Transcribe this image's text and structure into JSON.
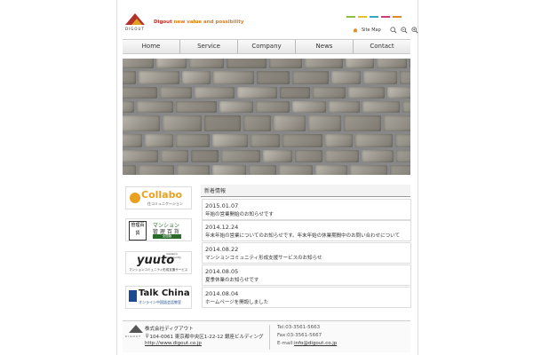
{
  "header": {
    "logo_word": "DIGOUT",
    "tagline_brand": "Digout",
    "tagline_rest": " new value and possibility",
    "colorbar_colors": [
      "#8cbf3f",
      "#e1c22c",
      "#3aa5c9",
      "#d33a7c",
      "#e08a26"
    ],
    "site_map_label": "Site Map",
    "zoom_icons": [
      "zoom-reset-icon",
      "zoom-out-icon",
      "zoom-in-icon"
    ]
  },
  "nav": {
    "items": [
      {
        "label": "Home"
      },
      {
        "label": "Service"
      },
      {
        "label": "Company"
      },
      {
        "label": "News"
      },
      {
        "label": "Contact"
      }
    ]
  },
  "banners": {
    "collabo": {
      "title": "Collabo",
      "sub": "住コミュニケーション"
    },
    "mansion": {
      "box": "管理百貨",
      "line1": "マンション",
      "line2": "管 理 百 貨",
      "tag": "全国版"
    },
    "yuuto": {
      "mini": "mansion community",
      "title": "yuuto",
      "sub": "マンションコミュニティ形成支援サービス"
    },
    "talk": {
      "title": "Talk China",
      "sub": "オンライン中国語会話教室"
    }
  },
  "news": {
    "heading": "新着情報",
    "items": [
      {
        "date": "2015.01.07",
        "title": "年始の営業開始のお知らせです"
      },
      {
        "date": "2014.12.24",
        "title": "年末年始の営業についてのお知らせです。年末年始の休業期間中のお問い合わせについて"
      },
      {
        "date": "2014.08.22",
        "title": "マンションコミュニティ形成支援サービスのお知らせ"
      },
      {
        "date": "2014.08.05",
        "title": "夏季休業のお知らせです"
      },
      {
        "date": "2014.08.04",
        "title": "ホームページを開設しました"
      }
    ]
  },
  "footer": {
    "company": "株式会社ディグアウト",
    "address": "〒104-0061 東京都中央区1-22-12 銀座ビルディング",
    "url": "http://www.digout.co.jp",
    "tel": "Tel:03-3561-5663",
    "fax": "Fax:03-3561-5667",
    "email_label": "E-mail:",
    "email": "info@digout.co.jp"
  }
}
